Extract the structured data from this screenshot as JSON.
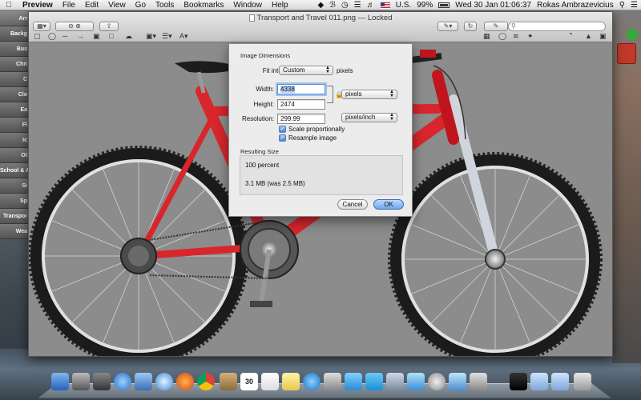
{
  "menubar": {
    "app": "Preview",
    "items": [
      "File",
      "Edit",
      "View",
      "Go",
      "Tools",
      "Bookmarks",
      "Window",
      "Help"
    ],
    "status": {
      "input_source": "U.S.",
      "battery": "99%",
      "datetime": "Wed 30 Jan  01:06:37",
      "user": "Rokas Ambrazevicius"
    }
  },
  "sidebar": {
    "categories": [
      "Arr",
      "Backg",
      "Bus",
      "Chri",
      "C",
      "Clo",
      "Ea",
      "Fl",
      "Ic",
      "Ot",
      "School & A",
      "Si",
      "Sp",
      "Transpor",
      "Wea"
    ]
  },
  "window": {
    "title": "Transport and Travel 011.png",
    "locked": "— Locked"
  },
  "dialog": {
    "section_dimensions": "Image Dimensions",
    "fit_into_label": "Fit into:",
    "fit_into_value": "Custom",
    "fit_into_unit": "pixels",
    "width_label": "Width:",
    "width_value": "4338",
    "height_label": "Height:",
    "height_value": "2474",
    "size_unit": "pixels",
    "resolution_label": "Resolution:",
    "resolution_value": "299.99",
    "resolution_unit": "pixels/inch",
    "scale_label": "Scale proportionally",
    "scale_checked": true,
    "resample_label": "Resample image",
    "resample_checked": true,
    "section_result": "Resulting Size",
    "result_percent": "100 percent",
    "result_size": "3.1 MB (was 2.5 MB)",
    "cancel_label": "Cancel",
    "ok_label": "OK"
  },
  "dock": {
    "calendar_day": "30",
    "calendar_month": "JAN"
  },
  "colors": {
    "frame_red": "#d8262c",
    "dialog_bg": "#ececec",
    "accent_blue": "#6ea7ee"
  }
}
